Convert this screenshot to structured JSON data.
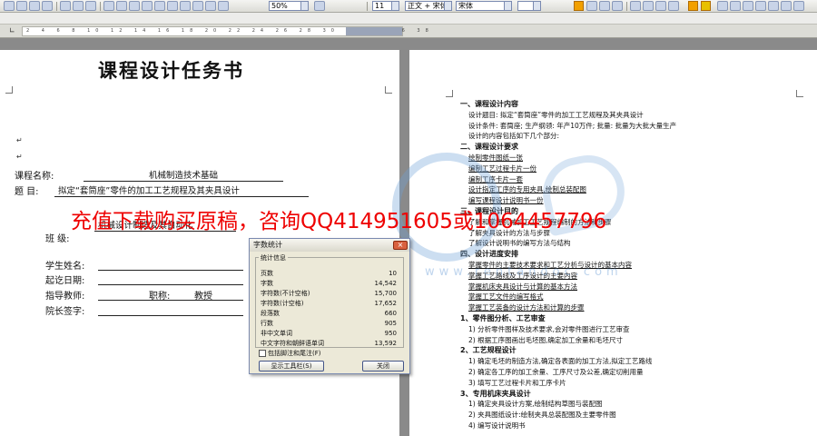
{
  "toolbar": {
    "zoom": "50%",
    "font_size": "11",
    "style": "正文 + 宋体",
    "font_name": "宋体"
  },
  "ruler": {
    "ticks": "2 4 6 8 10 12 14 16 18 20 22 24 26 28 30 32 34 36 38"
  },
  "left_page": {
    "title": "课程设计任务书",
    "fields": [
      {
        "label": "课程名称:",
        "value": "机械制造技术基础"
      },
      {
        "label": "题    目:",
        "value": "拟定“套筒座”零件的加工工艺规程及其夹具设计"
      }
    ],
    "partial_value": "机械设计制造及其自动化",
    "labels": [
      "班    级:",
      "学生姓名:",
      "起讫日期:",
      "指导教师:",
      "院长签字:"
    ],
    "advisor_title_label": "职称:",
    "advisor_title_value": "教授"
  },
  "promo_text": "充值下载购买原稿，咨询QQ414951605或1064457796",
  "watermark_domain": "www.rentandoc.com",
  "dialog": {
    "title": "字数统计",
    "group_label": "统计信息",
    "rows": [
      {
        "k": "页数",
        "v": "10"
      },
      {
        "k": "字数",
        "v": "14,542"
      },
      {
        "k": "字符数(不计空格)",
        "v": "15,700"
      },
      {
        "k": "字符数(计空格)",
        "v": "17,652"
      },
      {
        "k": "段落数",
        "v": "660"
      },
      {
        "k": "行数",
        "v": "905"
      },
      {
        "k": "非中文单词",
        "v": "950"
      },
      {
        "k": "中文字符和朝鲜语单词",
        "v": "13,592"
      }
    ],
    "checkbox_label": "包括脚注和尾注(F)",
    "toolbar_button": "显示工具栏(S)",
    "close_button": "关闭"
  },
  "right_page": {
    "lines": [
      {
        "t": "一、课程设计内容",
        "s": "b"
      },
      {
        "t": "设计题目: 拟定“套筒座”零件的加工工艺规程及其夹具设计",
        "s": ""
      },
      {
        "t": "设计条件: 套筒座; 生产纲领: 年产10万件; 批量: 批量为大批大量生产",
        "s": ""
      },
      {
        "t": "设计的内容包括如下几个部分:",
        "s": ""
      },
      {
        "t": "二、课程设计要求",
        "s": "b"
      },
      {
        "t": "绘制零件图纸一张",
        "s": "u"
      },
      {
        "t": "编制工艺过程卡片一份",
        "s": "u"
      },
      {
        "t": "编制工序卡片一套",
        "s": "u"
      },
      {
        "t": "设计指定工序的专用夹具,绘制总装配图",
        "s": "u"
      },
      {
        "t": "编写课程设计说明书一份",
        "s": "u"
      },
      {
        "t": "三、课程设计目的",
        "s": "b"
      },
      {
        "t": "了解和掌握机械加工工艺规程编制的方法和步骤",
        "s": ""
      },
      {
        "t": "了解夹具设计的方法与步骤",
        "s": ""
      },
      {
        "t": "了解设计说明书的编写方法与结构",
        "s": ""
      },
      {
        "t": "四、设计进度安排",
        "s": "b"
      },
      {
        "t": "掌握零件的主要技术要求和工艺分析与设计的基本内容",
        "s": "u"
      },
      {
        "t": "掌握工艺路线及工序设计的主要内容",
        "s": "u"
      },
      {
        "t": "掌握机床夹具设计与计算的基本方法",
        "s": "u"
      },
      {
        "t": "掌握工艺文件的编写格式",
        "s": "u"
      },
      {
        "t": "掌握工艺装备的设计方法和计算的步骤",
        "s": "u"
      },
      {
        "t": "1、零件图分析、工艺审查",
        "s": "b"
      },
      {
        "t": "1) 分析零件图样及技术要求,会对零件图进行工艺审查",
        "s": ""
      },
      {
        "t": "2) 根据工序图画出毛坯图,确定加工余量和毛坯尺寸",
        "s": ""
      },
      {
        "t": "2、工艺规程设计",
        "s": "b"
      },
      {
        "t": "1) 确定毛坯的制造方法,确定各表面的加工方法,拟定工艺路线",
        "s": ""
      },
      {
        "t": "2) 确定各工序的加工余量、工序尺寸及公差,确定切削用量",
        "s": ""
      },
      {
        "t": "3) 填写工艺过程卡片和工序卡片",
        "s": ""
      },
      {
        "t": "3、专用机床夹具设计",
        "s": "b"
      },
      {
        "t": "1) 确定夹具设计方案,绘制结构草图与装配图",
        "s": ""
      },
      {
        "t": "2) 夹具图纸设计:绘制夹具总装配图及主要零件图",
        "s": ""
      },
      {
        "t": "4) 编写设计说明书",
        "s": ""
      }
    ]
  }
}
